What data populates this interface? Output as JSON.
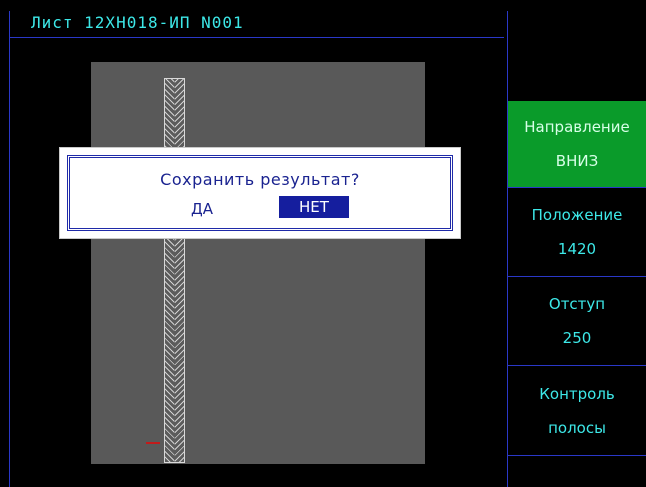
{
  "header": {
    "title": "Лист 12ХН018-ИП N001"
  },
  "sidebar": {
    "items": [
      {
        "label": "Направление",
        "value": "ВНИЗ",
        "active": true
      },
      {
        "label": "Положение",
        "value": "1420",
        "active": false
      },
      {
        "label": "Отступ",
        "value": "250",
        "active": false
      },
      {
        "label": "Контроль",
        "value": "полосы",
        "active": false
      }
    ]
  },
  "dialog": {
    "message": "Сохранить результат?",
    "yes_label": "ДА",
    "no_label": "НЕТ"
  },
  "colors": {
    "text": "#3de8e8",
    "frame": "#2a38c8",
    "active_button": "#0a9b2a",
    "sheet": "#595959",
    "dialog_accent": "#151e9e"
  }
}
